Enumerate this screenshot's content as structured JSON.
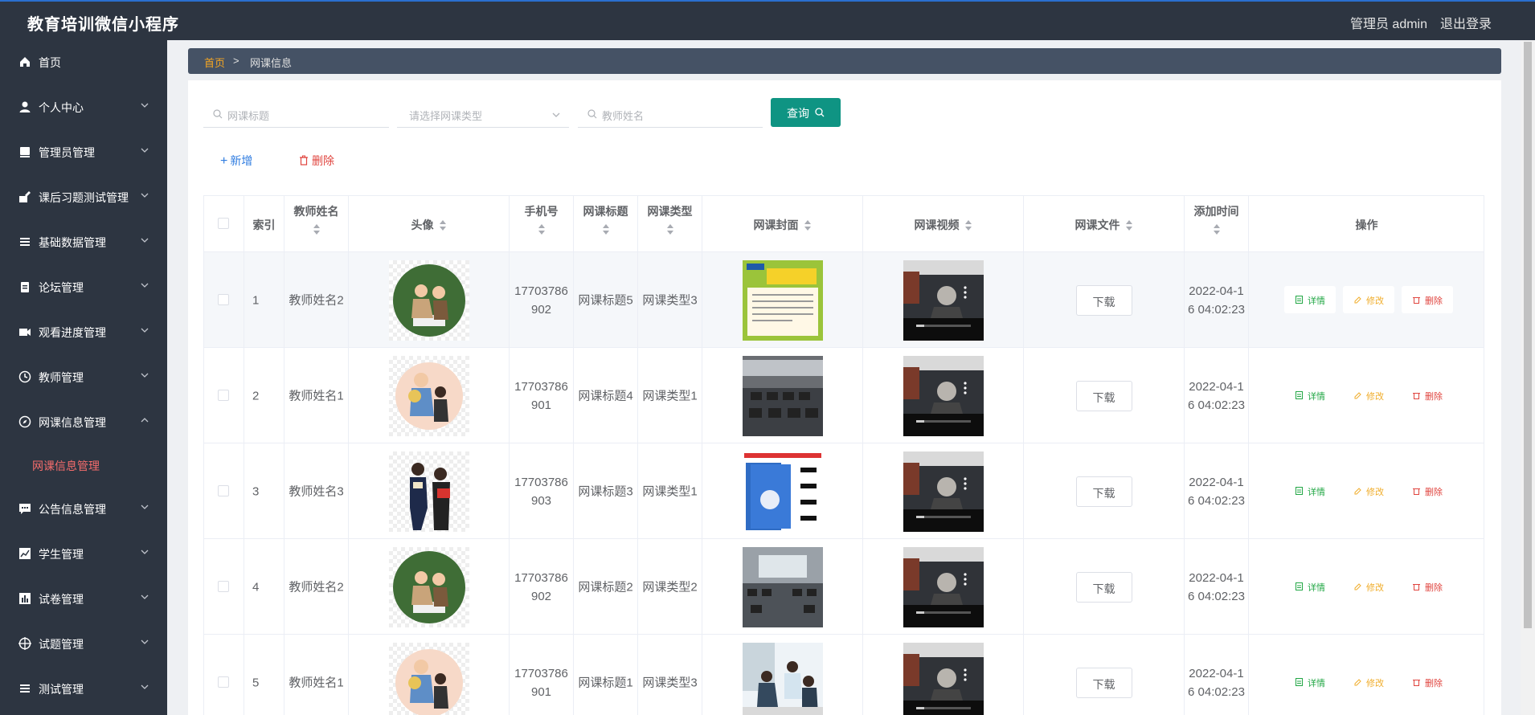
{
  "app": {
    "title": "教育培训微信小程序",
    "user": "管理员 admin",
    "logout": "退出登录"
  },
  "sidebar": {
    "items": [
      {
        "label": "首页",
        "icon": "home-icon"
      },
      {
        "label": "个人中心",
        "icon": "user-icon"
      },
      {
        "label": "管理员管理",
        "icon": "book-icon"
      },
      {
        "label": "课后习题测试管理",
        "icon": "edit-icon"
      },
      {
        "label": "基础数据管理",
        "icon": "list-icon"
      },
      {
        "label": "论坛管理",
        "icon": "clipboard-icon"
      },
      {
        "label": "观看进度管理",
        "icon": "camera-icon"
      },
      {
        "label": "教师管理",
        "icon": "clock-icon"
      },
      {
        "label": "网课信息管理",
        "icon": "compass-icon"
      },
      {
        "label": "公告信息管理",
        "icon": "chat-icon"
      },
      {
        "label": "学生管理",
        "icon": "chart-icon"
      },
      {
        "label": "试卷管理",
        "icon": "bar-icon"
      },
      {
        "label": "试题管理",
        "icon": "target-icon"
      },
      {
        "label": "测试管理",
        "icon": "list-icon"
      }
    ],
    "active_sub": "网课信息管理"
  },
  "breadcrumb": {
    "home": "首页",
    "sep": ">",
    "current": "网课信息"
  },
  "search": {
    "title_placeholder": "网课标题",
    "type_placeholder": "请选择网课类型",
    "teacher_placeholder": "教师姓名",
    "query_label": "查询"
  },
  "actions": {
    "add_label": "新增",
    "delete_label": "删除"
  },
  "table": {
    "headers": {
      "index": "索引",
      "teacher": "教师姓名",
      "avatar": "头像",
      "phone": "手机号",
      "course_title": "网课标题",
      "course_type": "网课类型",
      "cover": "网课封面",
      "video": "网课视频",
      "file": "网课文件",
      "added": "添加时间",
      "ops": "操作"
    },
    "download_label": "下载",
    "op_labels": {
      "detail": "详情",
      "edit": "修改",
      "delete": "删除"
    },
    "rows": [
      {
        "index": "1",
        "teacher": "教师姓名2",
        "phone": "17703786902",
        "course_title": "网课标题5",
        "course_type": "网课类型3",
        "added": "2022-04-16 04:02:23"
      },
      {
        "index": "2",
        "teacher": "教师姓名1",
        "phone": "17703786901",
        "course_title": "网课标题4",
        "course_type": "网课类型1",
        "added": "2022-04-16 04:02:23"
      },
      {
        "index": "3",
        "teacher": "教师姓名3",
        "phone": "17703786903",
        "course_title": "网课标题3",
        "course_type": "网课类型1",
        "added": "2022-04-16 04:02:23"
      },
      {
        "index": "4",
        "teacher": "教师姓名2",
        "phone": "17703786902",
        "course_title": "网课标题2",
        "course_type": "网课类型2",
        "added": "2022-04-16 04:02:23"
      },
      {
        "index": "5",
        "teacher": "教师姓名1",
        "phone": "17703786901",
        "course_title": "网课标题1",
        "course_type": "网课类型3",
        "added": "2022-04-16 04:02:23"
      }
    ]
  },
  "colors": {
    "teal": "#0f9483",
    "sidebar": "#2d3541",
    "active": "#f56c6c",
    "detail": "#22a745",
    "edit": "#f0ad2b",
    "delete": "#e0443e"
  }
}
